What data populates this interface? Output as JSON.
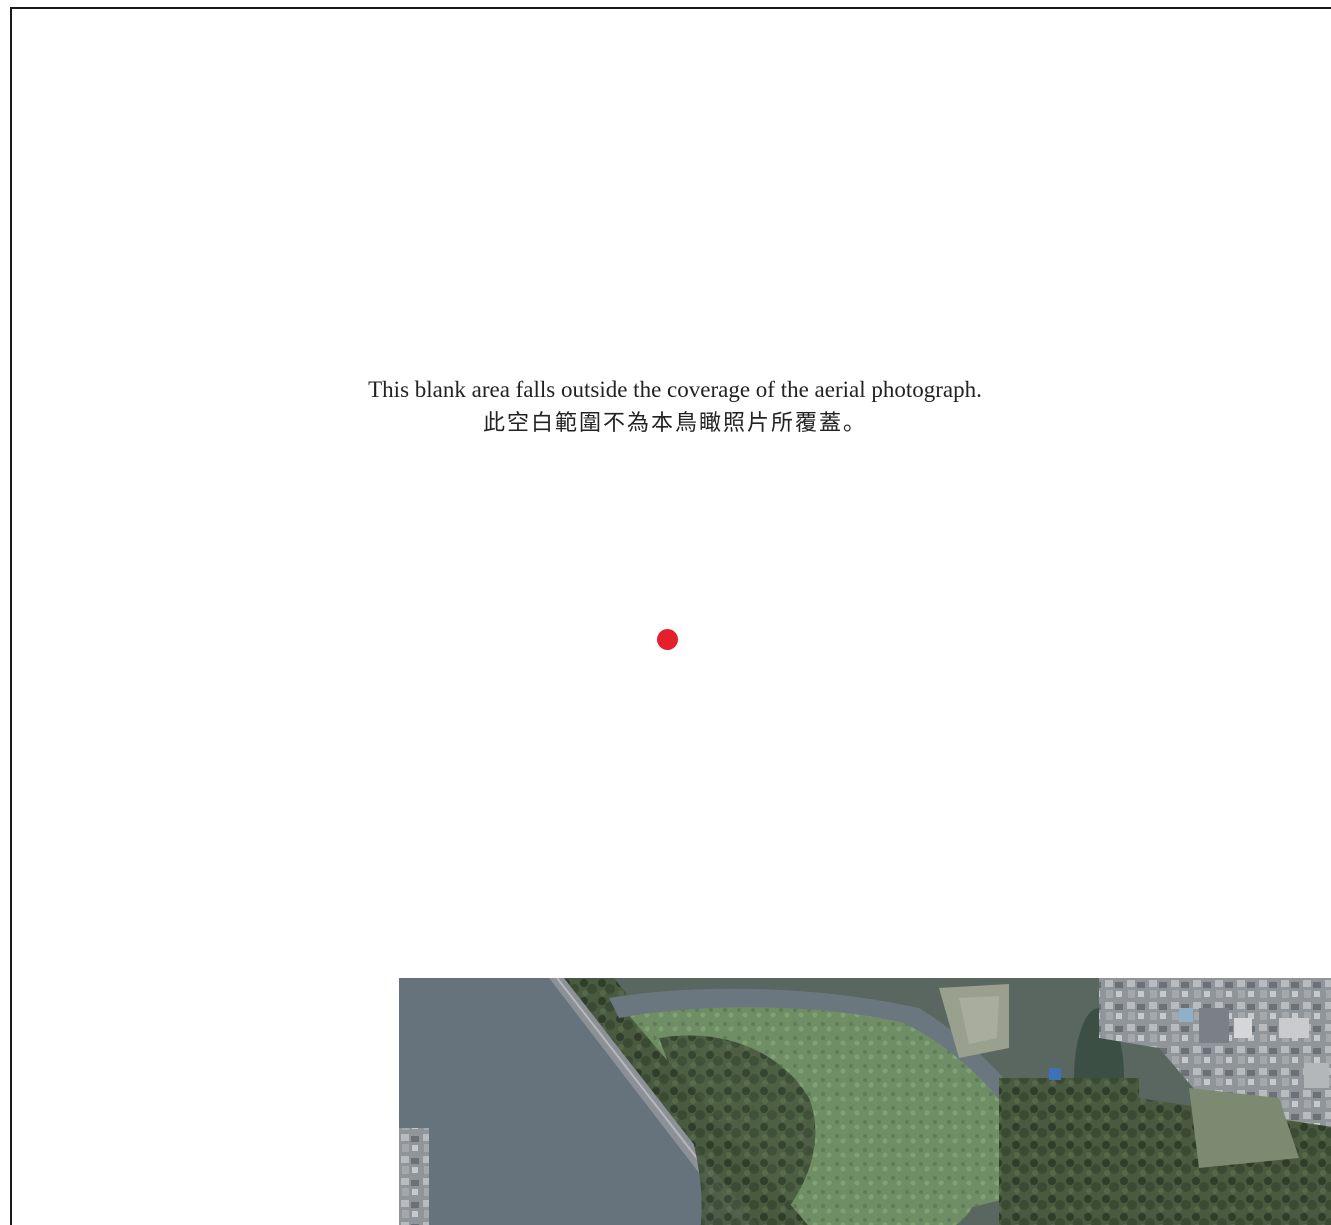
{
  "notice": {
    "text_en": "This blank area falls outside the coverage of the aerial photograph.",
    "text_zh": "此空白範圍不為本鳥瞰照片所覆蓋。"
  },
  "marker": {
    "color": "#e5202b",
    "icon": "location-dot-icon"
  },
  "colors": {
    "river": "#66727c",
    "vegetation": "#4d5f44",
    "urban": "#9a9ea2",
    "frame": "#1a1a1a"
  }
}
